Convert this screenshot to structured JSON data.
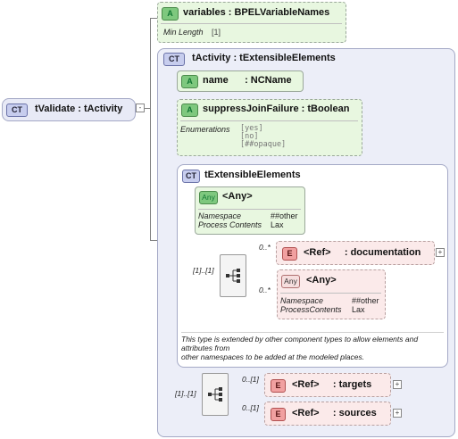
{
  "root": {
    "badge": "CT",
    "name": "tValidate : tActivity"
  },
  "variables": {
    "badge": "A",
    "title": "variables : BPELVariableNames",
    "facet_label": "Min Length",
    "facet_value": "[1]"
  },
  "activity": {
    "badge": "CT",
    "title": "tActivity   : tExtensibleElements"
  },
  "name_attr": {
    "badge": "A",
    "title": "name      : NCName"
  },
  "suppress": {
    "badge": "A",
    "title": "suppressJoinFailure : tBoolean",
    "enum_label": "Enumerations",
    "enum_values": [
      "[yes]",
      "[no]",
      "[##opaque]"
    ]
  },
  "ext": {
    "badge": "CT",
    "title": "tExtensibleElements"
  },
  "any_attr": {
    "badge": "Any",
    "title": "<Any>",
    "ns_label": "Namespace",
    "ns_value": "##other",
    "pc_label": "Process Contents",
    "pc_value": "Lax"
  },
  "ext_seq": {
    "cardinality": "[1]..[1]"
  },
  "documentation": {
    "badge": "E",
    "title": "<Ref>     : documentation",
    "cardinality": "0..*"
  },
  "any_elem": {
    "badge": "Any",
    "title": "<Any>",
    "ns_label": "Namespace",
    "ns_value": "##other",
    "pc_label": "ProcessContents",
    "pc_value": "Lax",
    "cardinality": "0..*"
  },
  "ext_note": "This type is extended by other component types to allow elements and attributes from\nother namespaces to be added at the modeled places.",
  "main_seq": {
    "cardinality": "[1]..[1]"
  },
  "targets": {
    "badge": "E",
    "title": "<Ref>     : targets",
    "cardinality": "0..[1]"
  },
  "sources": {
    "badge": "E",
    "title": "<Ref>     : sources",
    "cardinality": "0..[1]"
  },
  "expand_symbol": "+",
  "collapse_symbol": "-"
}
